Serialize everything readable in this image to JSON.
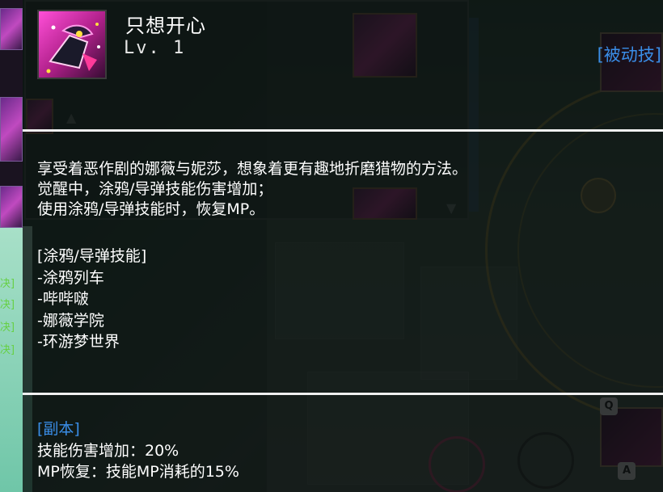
{
  "skill": {
    "name": "只想开心",
    "level": "Lv. 1",
    "type": "[被动技]",
    "icon": "graffiti-bird-skill-icon"
  },
  "description": {
    "lines": [
      "享受着恶作剧的娜薇与妮莎，想象着更有趣地折磨猎物的方法。",
      "觉醒中，涂鸦/导弹技能伤害增加；",
      "使用涂鸦/导弹技能时，恢复MP。"
    ]
  },
  "affected_skills": {
    "header": "[涂鸦/导弹技能]",
    "items": [
      "-涂鸦列车",
      "-哔哔啵",
      "-娜薇学院",
      "-环游梦世界"
    ]
  },
  "dungeon": {
    "header": "[副本]",
    "lines": [
      "技能伤害增加：20%",
      "MP恢复：技能MP消耗的15%"
    ]
  },
  "background": {
    "left_tags": [
      "决]",
      "决]",
      "决]",
      "决]"
    ],
    "key_badges": [
      "Q",
      "A"
    ]
  },
  "colors": {
    "accent_blue": "#3a8ee8",
    "text_white": "#ffffff",
    "panel_bg": "#080c0c",
    "divider": "#f0f0f0"
  }
}
